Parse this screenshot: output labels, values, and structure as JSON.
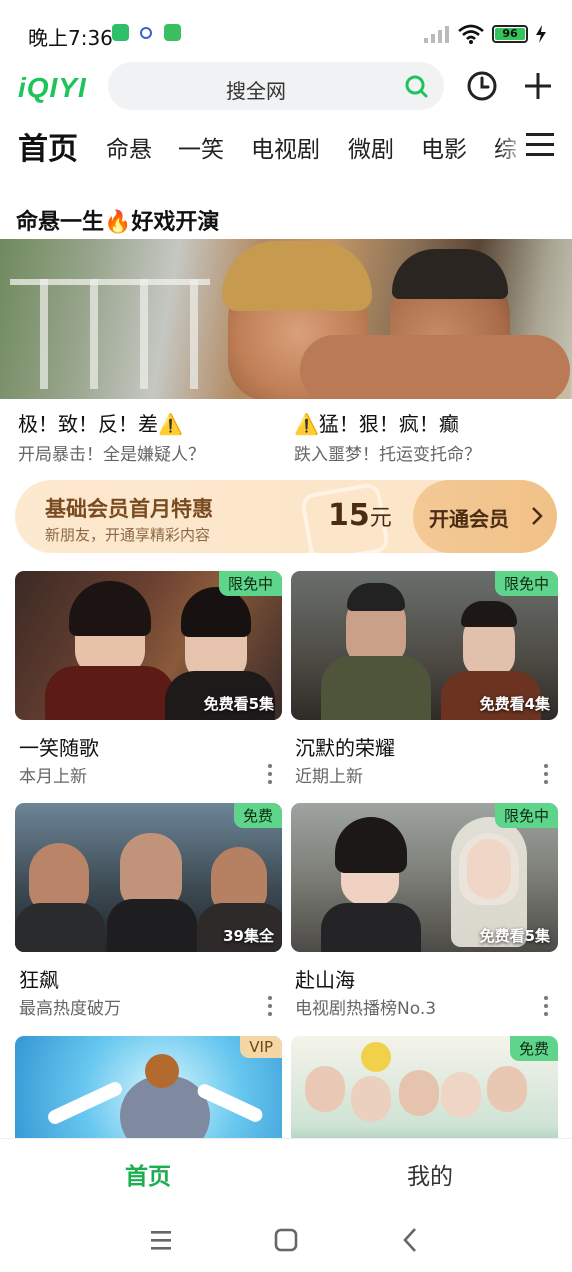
{
  "status_bar": {
    "time": "晚上7:36",
    "battery": "96"
  },
  "header": {
    "logo": "iQIYI",
    "search_placeholder": "搜全网"
  },
  "tabs": [
    "首页",
    "命悬",
    "一笑",
    "电视剧",
    "微剧",
    "电影",
    "综"
  ],
  "feature": {
    "title": "命悬一生🔥好戏开演",
    "items": [
      {
        "title": "极！致！反！差⚠️",
        "subtitle": "开局暴击！全是嫌疑人？"
      },
      {
        "title": "⚠️猛！狠！疯！癫",
        "subtitle": "跌入噩梦！托运变托命？"
      }
    ]
  },
  "vip_card": {
    "title": "基础会员首月特惠",
    "subtitle": "新朋友，开通享精彩内容",
    "price": "15",
    "unit": "元",
    "cta": "开通会员"
  },
  "cards": [
    {
      "title": "一笑随歌",
      "subtitle": "本月上新",
      "badge": "限免中",
      "episodes": "免费看5集"
    },
    {
      "title": "沉默的荣耀",
      "subtitle": "近期上新",
      "badge": "限免中",
      "episodes": "免费看4集"
    },
    {
      "title": "狂飙",
      "subtitle": "最高热度破万",
      "badge": "免费",
      "episodes": "39集全"
    },
    {
      "title": "赴山海",
      "subtitle": "电视剧热播榜No.3",
      "badge": "限免中",
      "episodes": "免费看5集"
    },
    {
      "title": "",
      "subtitle": "",
      "badge": "VIP",
      "episodes": ""
    },
    {
      "title": "",
      "subtitle": "",
      "badge": "免费",
      "episodes": ""
    }
  ],
  "bottom_nav": {
    "home": "首页",
    "me": "我的"
  },
  "colors": {
    "brand": "#1ec45a",
    "tab_active": "#1aae4f",
    "badge_green": "#5ed58b"
  }
}
